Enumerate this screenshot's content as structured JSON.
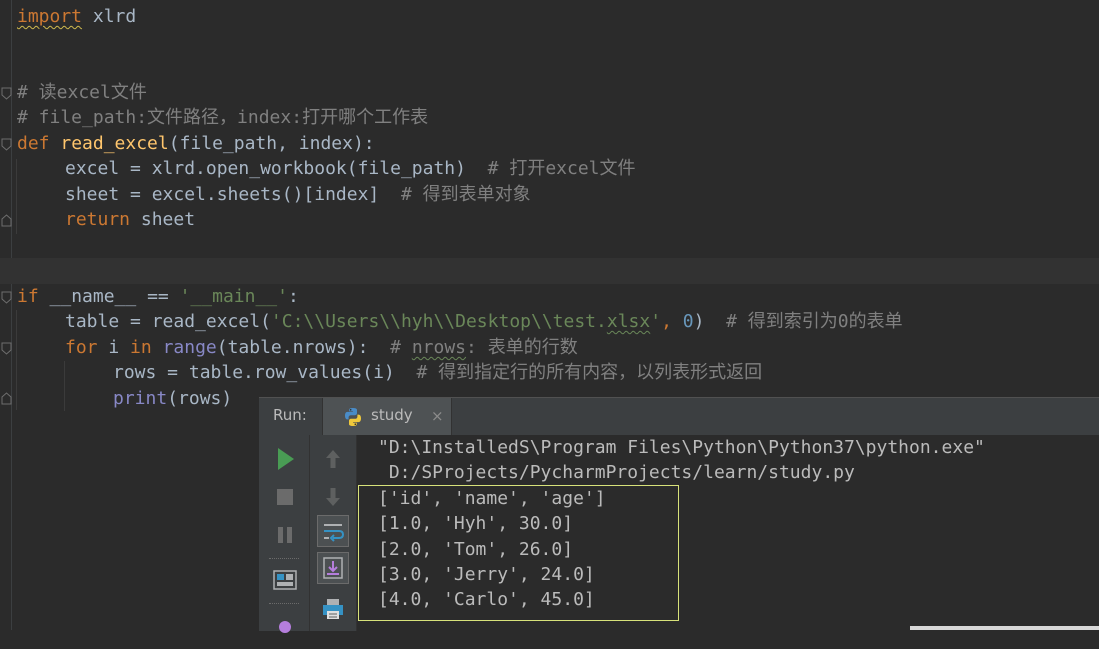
{
  "editor": {
    "lines": {
      "l1_import": "import",
      "l1_mod": " xlrd",
      "c1": "# 读excel文件",
      "c2": "# file_path:文件路径，index:打开哪个工作表",
      "def_kw": "def",
      "def_name": "read_excel",
      "def_args": "(file_path, index):",
      "excel_assign": "excel = xlrd.open_workbook(file_path)",
      "excel_cm": "  # 打开excel文件",
      "sheet_assign": "sheet = excel.sheets()[index]",
      "sheet_cm": "  # 得到表单对象",
      "ret_kw": "return",
      "ret_val": " sheet",
      "if_kw": "if",
      "if_dunder": " __name__",
      "if_eq": " == ",
      "if_str": "'__main__'",
      "if_colon": ":",
      "table_pre": "table = read_excel(",
      "table_str_a": "'C:\\\\Users\\\\hyh\\\\Desktop\\\\test.",
      "table_str_b": "xlsx",
      "table_str_c": "'",
      "table_comma": ", ",
      "table_num": "0",
      "table_close": ")",
      "table_cm": "  # 得到索引为0的表单",
      "for_kw": "for",
      "for_i": " i ",
      "for_in": "in",
      "for_sp": " ",
      "for_range": "range",
      "for_args": "(table.nrows):",
      "for_cm_a": "  # ",
      "for_cm_b": "nrows",
      "for_cm_c": ": 表单的行数",
      "rows_assign": "rows = table.row_values(i)",
      "rows_cm": "  # 得到指定行的所有内容，以列表形式返回",
      "print_fn": "print",
      "print_args": "(rows)"
    }
  },
  "run_panel": {
    "label": "Run:",
    "tab_label": "study",
    "tab_close": "×",
    "output": [
      "\"D:\\InstalledS\\Program Files\\Python\\Python37\\python.exe\"",
      " D:/SProjects/PycharmProjects/learn/study.py",
      "['id', 'name', 'age']",
      "[1.0, 'Hyh', 30.0]",
      "[2.0, 'Tom', 26.0]",
      "[3.0, 'Jerry', 24.0]",
      "[4.0, 'Carlo', 45.0]"
    ]
  },
  "colors": {
    "keyword": "#cc7832",
    "function": "#ffc66d",
    "comment": "#808080",
    "string": "#6a8759",
    "number": "#6897bb",
    "builtin": "#8888c6",
    "run_green": "#499c54",
    "highlight": "#d8e27a"
  },
  "icons": [
    "fold-icon",
    "python-icon",
    "close-icon",
    "run-icon",
    "stop-icon",
    "pause-icon",
    "layout-icon",
    "up-arrow-icon",
    "down-arrow-icon",
    "soft-wrap-icon",
    "scroll-to-end-icon",
    "print-icon"
  ]
}
